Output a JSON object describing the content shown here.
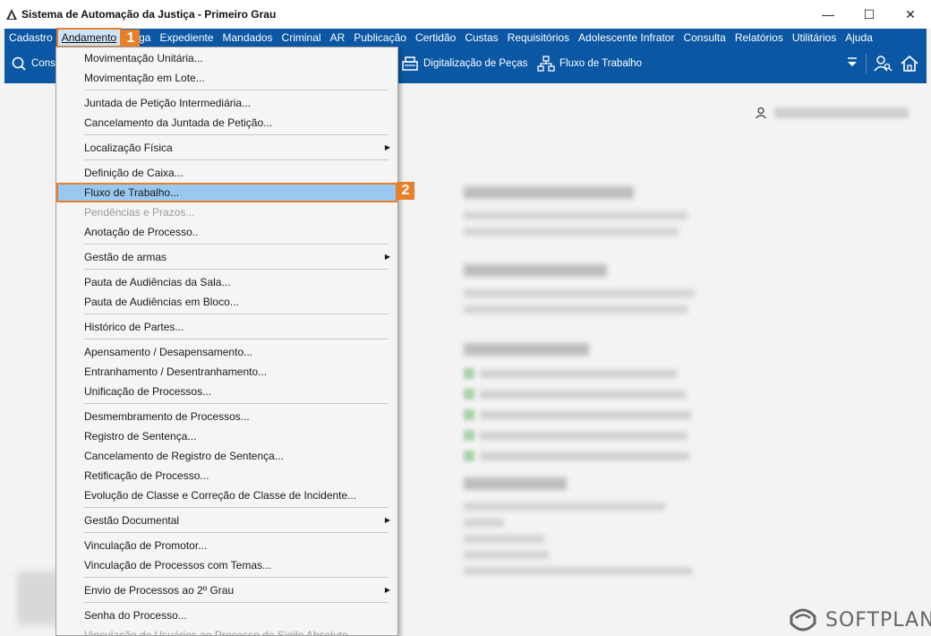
{
  "window": {
    "title": "Sistema de Automação da Justiça - Primeiro Grau"
  },
  "menubar": [
    "Cadastro",
    "Andamento",
    "Carga",
    "Expediente",
    "Mandados",
    "Criminal",
    "AR",
    "Publicação",
    "Certidão",
    "Custas",
    "Requisitórios",
    "Adolescente Infrator",
    "Consulta",
    "Relatórios",
    "Utilitários",
    "Ajuda"
  ],
  "menubar_partial": {
    "carga_visible": "ga"
  },
  "toolbar": {
    "consulta": "Cons",
    "digitalizacao": "Digitalização de Peças",
    "fluxo": "Fluxo de Trabalho"
  },
  "callouts": {
    "one": "1",
    "two": "2"
  },
  "dropdown": [
    {
      "label": "Movimentação Unitária...",
      "sep_after": false
    },
    {
      "label": "Movimentação em Lote...",
      "sep_after": true
    },
    {
      "label": "Juntada de Petição Intermediária...",
      "sep_after": false
    },
    {
      "label": "Cancelamento da Juntada de Petição...",
      "sep_after": true
    },
    {
      "label": "Localização Física",
      "submenu": true,
      "sep_after": true
    },
    {
      "label": "Definição de Caixa...",
      "sep_after": false
    },
    {
      "label": "Fluxo de Trabalho...",
      "selected": true,
      "sep_after": false
    },
    {
      "label": "Pendências e Prazos...",
      "disabled": true,
      "sep_after": false
    },
    {
      "label": "Anotação de Processo..",
      "sep_after": true
    },
    {
      "label": "Gestão de armas",
      "submenu": true,
      "sep_after": true
    },
    {
      "label": "Pauta de Audiências da Sala...",
      "sep_after": false
    },
    {
      "label": "Pauta de Audiências em Bloco...",
      "sep_after": true
    },
    {
      "label": "Histórico de Partes...",
      "sep_after": true
    },
    {
      "label": "Apensamento / Desapensamento...",
      "sep_after": false
    },
    {
      "label": "Entranhamento / Desentranhamento...",
      "sep_after": false
    },
    {
      "label": "Unificação de Processos...",
      "sep_after": true
    },
    {
      "label": "Desmembramento de Processos...",
      "sep_after": false
    },
    {
      "label": "Registro de Sentença...",
      "sep_after": false
    },
    {
      "label": "Cancelamento de Registro de Sentença...",
      "sep_after": false
    },
    {
      "label": "Retificação de Processo...",
      "sep_after": false
    },
    {
      "label": "Evolução de Classe e Correção de Classe de Incidente...",
      "sep_after": true
    },
    {
      "label": "Gestão Documental",
      "submenu": true,
      "sep_after": true
    },
    {
      "label": "Vinculação de Promotor...",
      "sep_after": false
    },
    {
      "label": "Vinculação de Processos com Temas...",
      "sep_after": true
    },
    {
      "label": "Envio de Processos ao 2º Grau",
      "submenu": true,
      "sep_after": true
    },
    {
      "label": "Senha do Processo...",
      "sep_after": false
    },
    {
      "label": "Vinculação de Usuários ao Processo de Sigilo Absoluto...",
      "disabled": true,
      "sep_after": false
    }
  ],
  "brand": {
    "name": "SOFTPLAN"
  },
  "colors": {
    "chrome_blue": "#0b57a4",
    "callout_orange": "#e8802a",
    "selection_blue": "#99c8f0"
  }
}
